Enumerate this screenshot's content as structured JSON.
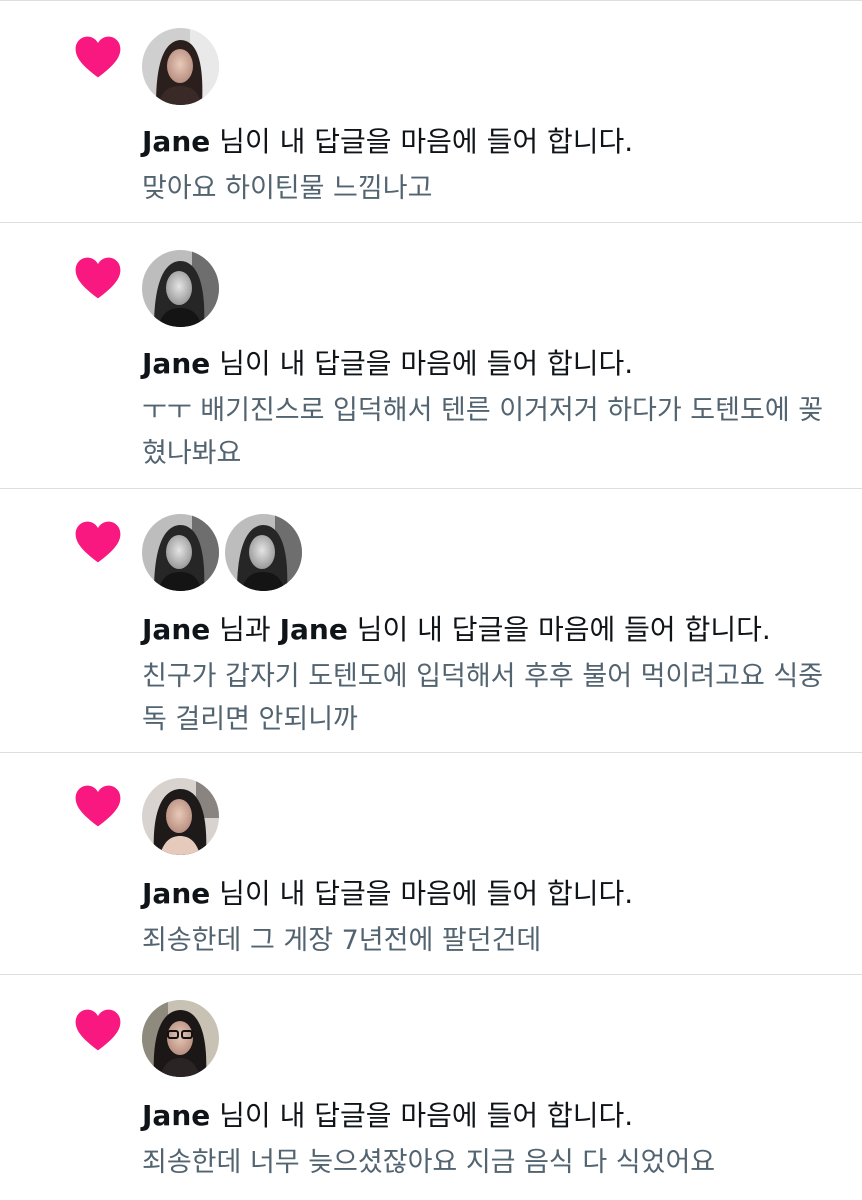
{
  "notifications": [
    {
      "icon": "heart-icon",
      "user": "Jane",
      "action_text": " 님이 내 답글을 마음에 들어 합니다.",
      "reply_text": "맞아요 하이틴물 느낌나고"
    },
    {
      "icon": "heart-icon",
      "user": "Jane",
      "action_text": " 님이 내 답글을 마음에 들어 합니다.",
      "reply_text": "ㅜㅜ 배기진스로 입덕해서 텐른 이거저거 하다가 도텐도에 꽂혔나봐요"
    },
    {
      "icon": "heart-icon",
      "user": "Jane",
      "conj_text": " 님과 ",
      "user2": "Jane",
      "action_text": " 님이 내 답글을 마음에 들어 합니다.",
      "reply_text": "친구가 갑자기 도텐도에 입덕해서 후후 불어 먹이려고요 식중독 걸리면 안되니까"
    },
    {
      "icon": "heart-icon",
      "user": "Jane",
      "action_text": " 님이 내 답글을 마음에 들어 합니다.",
      "reply_text": "죄송한데 그 게장 7년전에 팔던건데"
    },
    {
      "icon": "heart-icon",
      "user": "Jane",
      "action_text": " 님이 내 답글을 마음에 들어 합니다.",
      "reply_text": "죄송한데 너무 늦으셨잖아요 지금 음식 다 식었어요"
    }
  ],
  "colors": {
    "heart": "#f91880",
    "primary_text": "#0f1419",
    "secondary_text": "#536471",
    "divider": "#dcdfe2"
  }
}
